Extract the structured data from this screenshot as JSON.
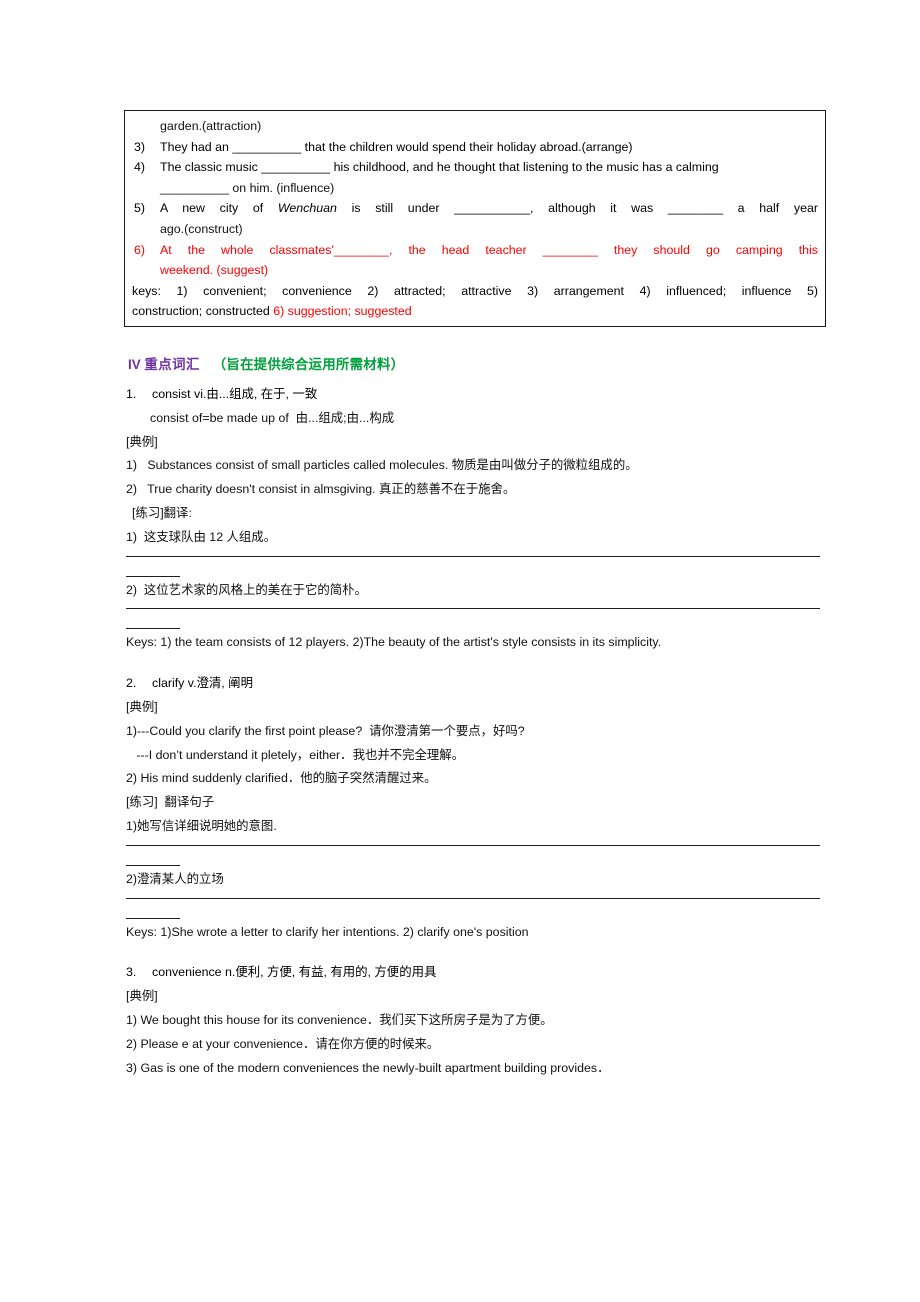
{
  "document": {
    "exercise_box": {
      "orphan_line": "garden.(attraction)",
      "items": [
        {
          "num": "3)",
          "segments": [
            {
              "t": "They had an ",
              "style": "plain"
            },
            {
              "t": "__________",
              "style": "blank"
            },
            {
              "t": " that the children would spend their holiday abroad.(arrange)",
              "style": "plain"
            }
          ],
          "plain": "They had an __________ that the children would spend their holiday abroad.(arrange)"
        },
        {
          "num": "4)",
          "plain": "The classic music __________ his childhood, and he thought that listening to the music has a calming __________ on him. (influence)",
          "line1": "The classic music __________ his childhood, and he thought that listening to the music has a calming",
          "line2": "__________ on him. (influence)"
        },
        {
          "num": "5)",
          "plain": "A new city of Wenchuan is still under ___________, although it was ________ a half year ago.(construct)",
          "line1_a": "A new city of ",
          "line1_ital": "Wenchuan",
          "line1_b": " is still under ___________, although it was ________ a half year",
          "line2": "ago.(construct)"
        },
        {
          "num": "6)",
          "color": "#ff0000",
          "plain": "At the whole classmates'________, the head teacher ________ they should go camping this weekend. (suggest)",
          "line1": "At the whole classmates'________, the head teacher ________ they should go camping this",
          "line2": "weekend. (suggest)"
        }
      ],
      "keys_line1": "keys: 1) convenient; convenience 2) attracted; attractive 3) arrangement 4) influenced; influence 5)",
      "keys_line2_black": "construction; constructed ",
      "keys_line2_red": "6) suggestion; suggested"
    },
    "section_heading": {
      "roman": "IV",
      "title_cn": "重点词汇",
      "note_cn": "（旨在提供综合运用所需材料）",
      "color_title": "#7030A0",
      "color_note": "#00A03C"
    },
    "entries": [
      {
        "index": "1.",
        "headword": "consist vi.由...组成, 在于, 一致",
        "subline": "consist of=be made up of  由...组成;由...构成",
        "examples_label": "[典例]",
        "examples": [
          "1)   Substances consist of small particles called molecules. 物质是由叫做分子的微粒组成的。",
          "2)   True charity doesn't consist in almsgiving. 真正的慈善不在于施舍。"
        ],
        "practice_label": "[练习]翻译:",
        "practice": [
          "1)  这支球队由 12 人组成。",
          "2)  这位艺术家的风格上的美在于它的简朴。"
        ],
        "keys": "Keys: 1) the team consists of 12 players. 2)The beauty of the artist's style consists in its simplicity."
      },
      {
        "index": "2.",
        "headword": "clarify v.澄清, 阐明",
        "examples_label": "[典例]",
        "examples": [
          "1)---Could you clarify the first point please?  请你澄清第一个要点，好吗?",
          "   ---I don’t understand it pletely，either．我也并不完全理解。",
          "2) His mind suddenly clarified．他的脑子突然清醒过来。"
        ],
        "practice_label": "[练习]  翻译句子",
        "practice": [
          "1)她写信详细说明她的意图.",
          "2)澄清某人的立场"
        ],
        "keys": "Keys: 1)She wrote a letter to clarify her intentions. 2) clarify one's position"
      },
      {
        "index": "3.",
        "headword": "convenience n.便利, 方便, 有益, 有用的, 方便的用具",
        "examples_label": "[典例]",
        "examples": [
          "1) We bought this house for its convenience．我们买下这所房子是为了方便。",
          "2) Please e at your convenience．请在你方便的时候来。",
          "3) Gas is one of the modern conveniences the newly-built apartment building provides．"
        ]
      }
    ]
  }
}
